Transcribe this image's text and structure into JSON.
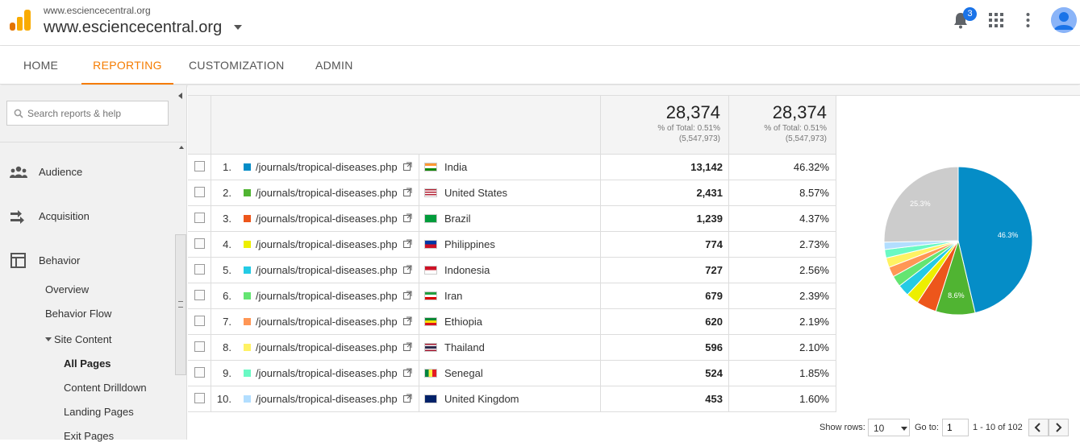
{
  "header": {
    "account_small": "www.escience​central.org",
    "account_big": "www.escience​central.org",
    "notification_count": "3"
  },
  "nav": {
    "tabs": [
      {
        "label": "HOME"
      },
      {
        "label": "REPORTING",
        "active": true
      },
      {
        "label": "CUSTOMIZATION"
      },
      {
        "label": "ADMIN"
      }
    ]
  },
  "sidebar": {
    "search_placeholder": "Search reports & help",
    "sections": [
      {
        "label": "Audience",
        "icon": "audience-icon"
      },
      {
        "label": "Acquisition",
        "icon": "acquisition-icon"
      },
      {
        "label": "Behavior",
        "icon": "behavior-icon"
      }
    ],
    "sub_items": {
      "overview": "Overview",
      "behavior_flow": "Behavior Flow",
      "site_content": "Site Content",
      "all_pages": "All Pages",
      "content_drilldown": "Content Drilldown",
      "landing_pages": "Landing Pages",
      "exit_pages": "Exit Pages"
    }
  },
  "totals": {
    "sessions": {
      "value": "28,374",
      "pct_line": "% of Total: 0.51%",
      "total_line": "(5,547,973)"
    },
    "contribution": {
      "value": "28,374",
      "pct_line": "% of Total: 0.51%",
      "total_line": "(5,547,973)"
    }
  },
  "rows": [
    {
      "num": "1.",
      "page": "/journals/tropical-diseases.php",
      "country": "India",
      "sessions": "13,142",
      "pct": "46.32%",
      "color": "#058dc7",
      "flag": "in"
    },
    {
      "num": "2.",
      "page": "/journals/tropical-diseases.php",
      "country": "United States",
      "sessions": "2,431",
      "pct": "8.57%",
      "color": "#50b432",
      "flag": "us"
    },
    {
      "num": "3.",
      "page": "/journals/tropical-diseases.php",
      "country": "Brazil",
      "sessions": "1,239",
      "pct": "4.37%",
      "color": "#ed561b",
      "flag": "br"
    },
    {
      "num": "4.",
      "page": "/journals/tropical-diseases.php",
      "country": "Philippines",
      "sessions": "774",
      "pct": "2.73%",
      "color": "#edef00",
      "flag": "ph"
    },
    {
      "num": "5.",
      "page": "/journals/tropical-diseases.php",
      "country": "Indonesia",
      "sessions": "727",
      "pct": "2.56%",
      "color": "#24cbe5",
      "flag": "id"
    },
    {
      "num": "6.",
      "page": "/journals/tropical-diseases.php",
      "country": "Iran",
      "sessions": "679",
      "pct": "2.39%",
      "color": "#64e572",
      "flag": "ir"
    },
    {
      "num": "7.",
      "page": "/journals/tropical-diseases.php",
      "country": "Ethiopia",
      "sessions": "620",
      "pct": "2.19%",
      "color": "#ff9655",
      "flag": "et"
    },
    {
      "num": "8.",
      "page": "/journals/tropical-diseases.php",
      "country": "Thailand",
      "sessions": "596",
      "pct": "2.10%",
      "color": "#fff263",
      "flag": "th"
    },
    {
      "num": "9.",
      "page": "/journals/tropical-diseases.php",
      "country": "Senegal",
      "sessions": "524",
      "pct": "1.85%",
      "color": "#6af9c4",
      "flag": "sn"
    },
    {
      "num": "10.",
      "page": "/journals/tropical-diseases.php",
      "country": "United Kingdom",
      "sessions": "453",
      "pct": "1.60%",
      "color": "#b2deff",
      "flag": "gb"
    }
  ],
  "pie": {
    "other_pct": 25.3,
    "other_color": "#cccccc",
    "labels": {
      "first": "46.3%",
      "second": "8.6%",
      "other": "25.3%"
    }
  },
  "footer": {
    "show_rows_label": "Show rows:",
    "rows_value": "10",
    "goto_label": "Go to:",
    "goto_value": "1",
    "range": "1 - 10 of 102"
  }
}
